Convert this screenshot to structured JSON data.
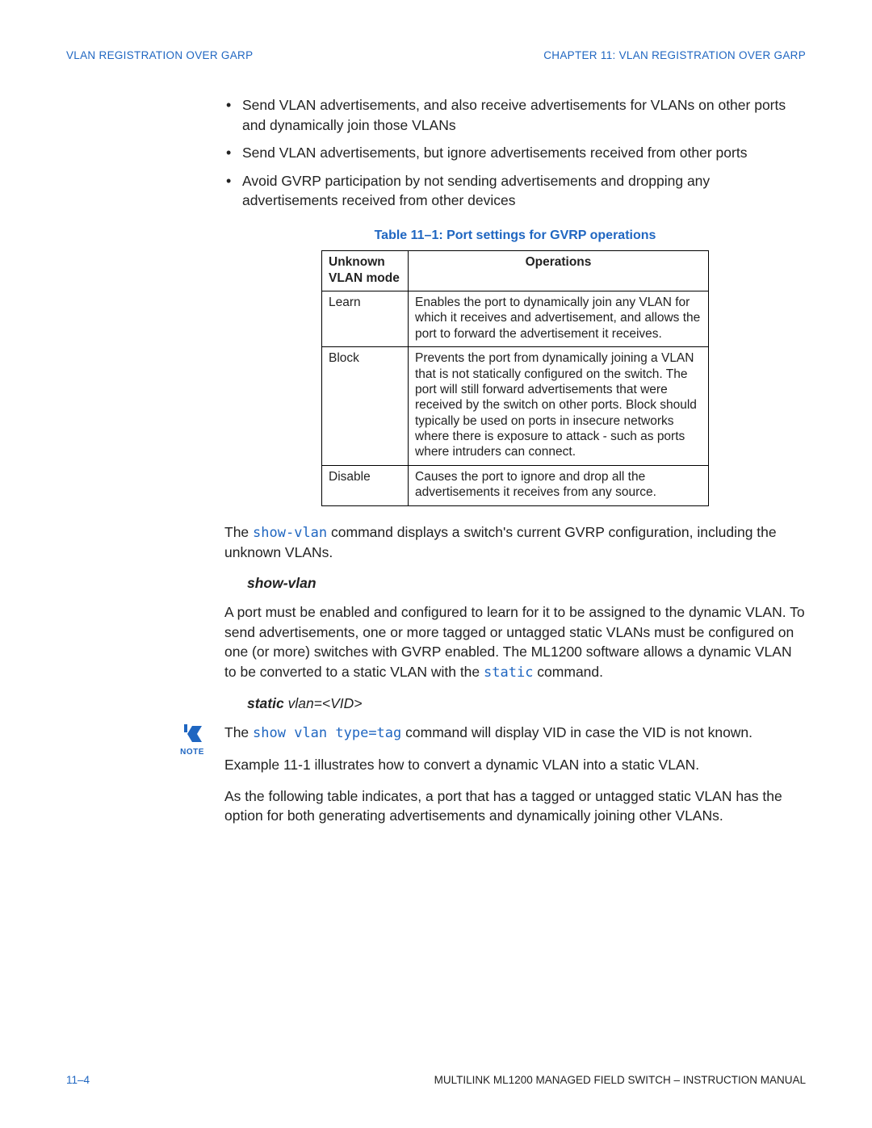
{
  "header": {
    "left": "VLAN REGISTRATION OVER GARP",
    "right": "CHAPTER 11:  VLAN REGISTRATION OVER GARP"
  },
  "bullets": [
    "Send VLAN advertisements, and also receive advertisements for VLANs on other ports and dynamically join those VLANs",
    "Send VLAN advertisements, but ignore advertisements received from other ports",
    "Avoid GVRP participation by not sending advertisements and dropping any advertisements received from other devices"
  ],
  "table": {
    "caption": "Table 11–1: Port settings for GVRP operations",
    "head_col1": "Unknown VLAN mode",
    "head_col2": "Operations",
    "rows": [
      {
        "mode": "Learn",
        "op": "Enables the port to dynamically join any VLAN for which it receives and advertisement, and allows the port to forward the advertisement it receives."
      },
      {
        "mode": "Block",
        "op": "Prevents the port from dynamically joining a VLAN that is not statically configured on the switch. The port will still forward advertisements that were received by the switch on other ports. Block should typically be used on ports in insecure networks where there is exposure to attack - such as ports where intruders can connect."
      },
      {
        "mode": "Disable",
        "op": "Causes the port to ignore and drop all the advertisements it receives from any source."
      }
    ]
  },
  "para1_a": "The ",
  "para1_cmd": "show-vlan",
  "para1_b": " command displays a switch's current GVRP configuration, including the unknown VLANs.",
  "cmd1": "show-vlan",
  "para2_a": "A port must be enabled and configured to learn for it to be assigned to the dynamic VLAN. To send advertisements, one or more tagged or untagged static VLANs must be configured on one (or more) switches with GVRP enabled. The ML1200 software allows a dynamic VLAN to be converted to a static VLAN with the ",
  "para2_cmd": "static",
  "para2_b": " command.",
  "cmd2_bold": "static",
  "cmd2_italic": " vlan=<VID>",
  "note": {
    "label": "NOTE"
  },
  "para3_a": "The ",
  "para3_cmd": "show vlan type=tag",
  "para3_b": " command will display VID in case the VID is not known.",
  "para4": "Example 11-1 illustrates how to convert a dynamic VLAN into a static VLAN.",
  "para5": "As the following table indicates, a port that has a tagged or untagged static VLAN has the option for both generating advertisements and dynamically joining other VLANs.",
  "footer": {
    "page": "11–4",
    "doc": "MULTILINK ML1200 MANAGED FIELD SWITCH – INSTRUCTION MANUAL"
  }
}
